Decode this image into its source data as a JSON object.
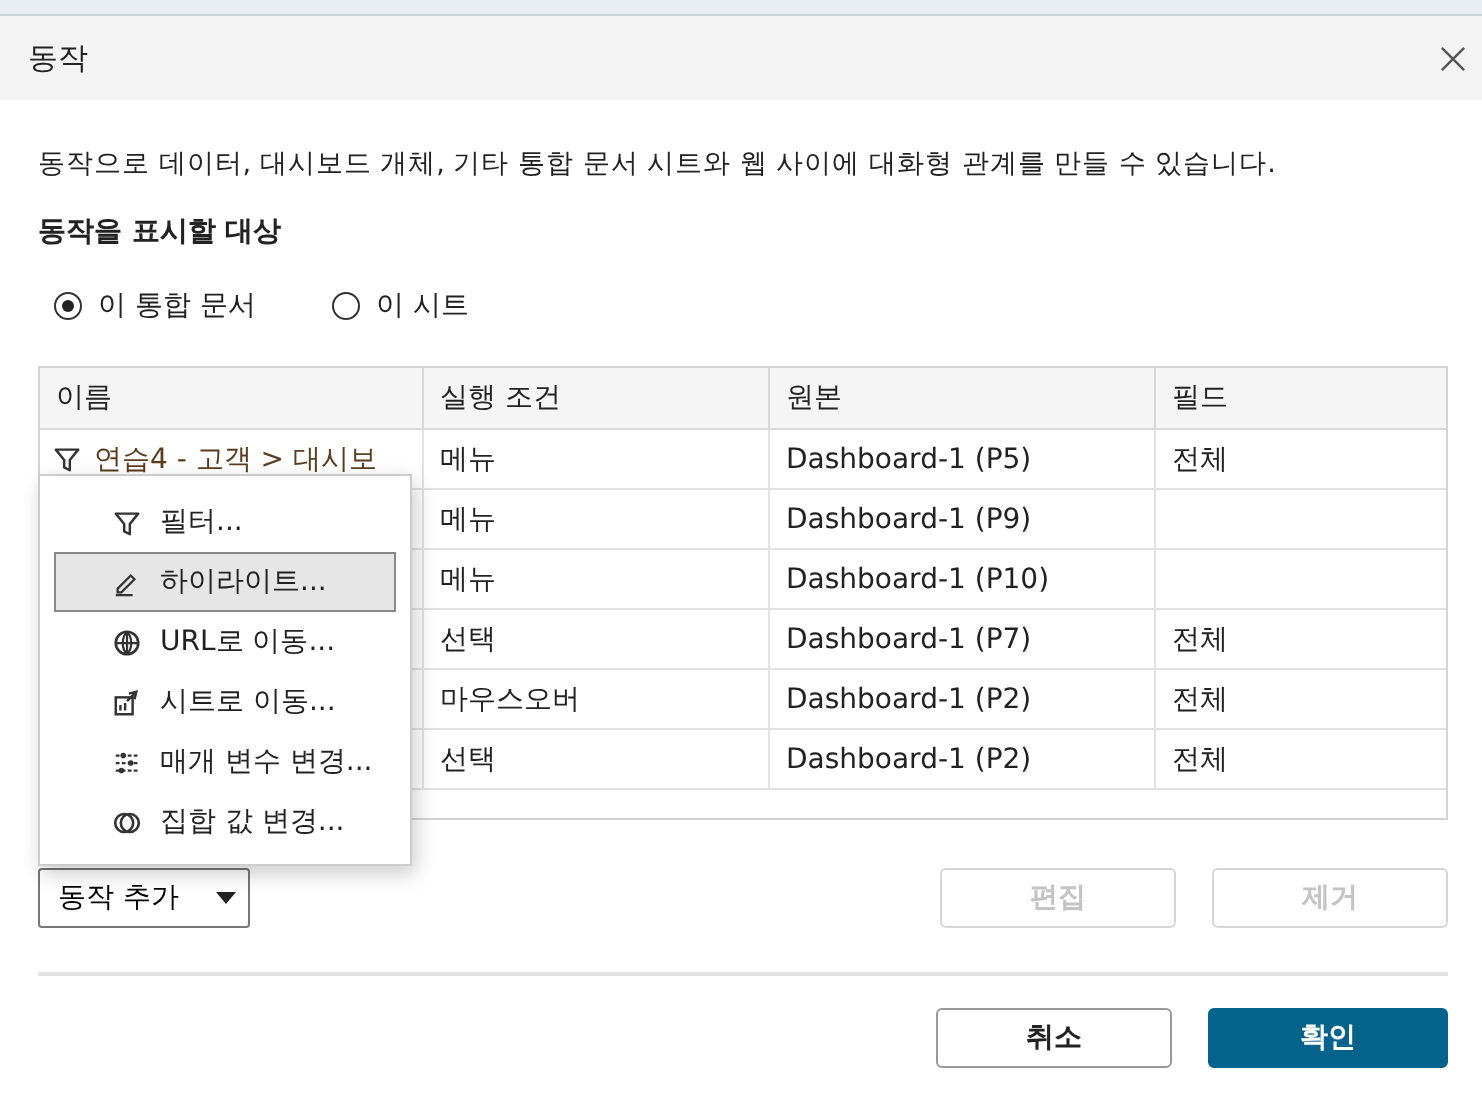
{
  "window": {
    "title": "동작"
  },
  "description": "동작으로 데이터, 대시보드 개체, 기타 통합 문서 시트와 웹 사이에 대화형 관계를 만들 수 있습니다.",
  "scope": {
    "label": "동작을 표시할 대상",
    "options": [
      {
        "label": "이 통합 문서",
        "selected": true
      },
      {
        "label": "이 시트",
        "selected": false
      }
    ]
  },
  "table": {
    "columns": [
      "이름",
      "실행 조건",
      "원본",
      "필드"
    ],
    "rows": [
      {
        "kind": "filter",
        "name": "연습4 - 고객 > 대시보",
        "condition": "메뉴",
        "source": "Dashboard-1 (P5)",
        "field": "전체"
      },
      {
        "condition": "메뉴",
        "source": "Dashboard-1 (P9)"
      },
      {
        "condition": "메뉴",
        "source": "Dashboard-1 (P10)"
      },
      {
        "condition": "선택",
        "source": "Dashboard-1 (P7)",
        "field": "전체"
      },
      {
        "condition": "마우스오버",
        "source": "Dashboard-1 (P2)",
        "field": "전체"
      },
      {
        "condition": "선택",
        "source": "Dashboard-1 (P2)",
        "field": "전체"
      }
    ]
  },
  "add_menu": {
    "items": [
      {
        "kind": "filter",
        "label": "필터...",
        "selected": false
      },
      {
        "kind": "highlight",
        "label": "하이라이트...",
        "selected": true
      },
      {
        "kind": "url",
        "label": "URL로 이동...",
        "selected": false
      },
      {
        "kind": "sheet",
        "label": "시트로 이동...",
        "selected": false
      },
      {
        "kind": "parameter",
        "label": "매개 변수 변경...",
        "selected": false
      },
      {
        "kind": "set",
        "label": "집합 값 변경...",
        "selected": false
      }
    ]
  },
  "add_button": {
    "label": "동작 추가"
  },
  "edit_button": {
    "label": "편집",
    "disabled": true
  },
  "remove_button": {
    "label": "제거",
    "disabled": true
  },
  "cancel_button": {
    "label": "취소"
  },
  "ok_button": {
    "label": "확인"
  }
}
